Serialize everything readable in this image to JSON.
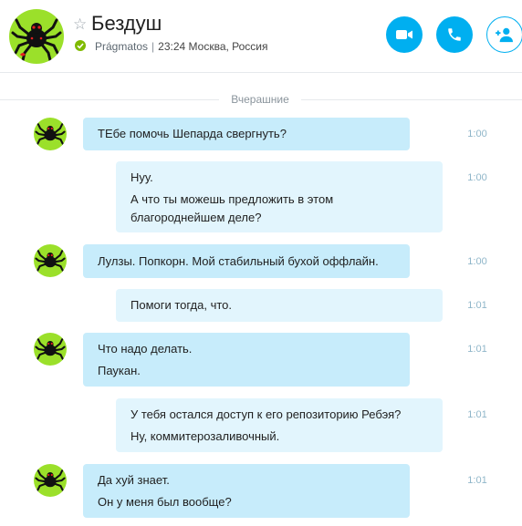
{
  "header": {
    "contact_name": "Бездуш",
    "mood": "Prágmatos",
    "separator": "|",
    "local_time": "23:24 Москва, Россия",
    "accent_color": "#00aff0",
    "presence_color": "#7fba00",
    "buttons": [
      {
        "name": "video-call-button",
        "icon": "video-camera-icon"
      },
      {
        "name": "audio-call-button",
        "icon": "phone-icon"
      },
      {
        "name": "add-people-button",
        "icon": "add-person-icon"
      }
    ]
  },
  "day_separator": "Вчерашние",
  "messages": [
    {
      "direction": "incoming",
      "time": "1:00",
      "lines": [
        "ТЕбе помочь Шепарда свергнуть?"
      ]
    },
    {
      "direction": "outgoing",
      "time": "1:00",
      "lines": [
        "Нуу.",
        "А что ты можешь предложить в этом",
        "благороднейшем деле?"
      ]
    },
    {
      "direction": "incoming",
      "time": "1:00",
      "lines": [
        "Лулзы. Попкорн. Мой стабильный бухой оффлайн."
      ]
    },
    {
      "direction": "outgoing",
      "time": "1:01",
      "lines": [
        "Помоги тогда, что."
      ]
    },
    {
      "direction": "incoming",
      "time": "1:01",
      "lines": [
        "Что надо делать.",
        "Паукан."
      ]
    },
    {
      "direction": "outgoing",
      "time": "1:01",
      "lines": [
        "У тебя остался доступ к его репозиторию Ребэя?",
        "Ну, коммитерозаливочный."
      ]
    },
    {
      "direction": "incoming",
      "time": "1:01",
      "lines": [
        "Да хуй знает.",
        "Он у меня был вообще?"
      ]
    }
  ]
}
